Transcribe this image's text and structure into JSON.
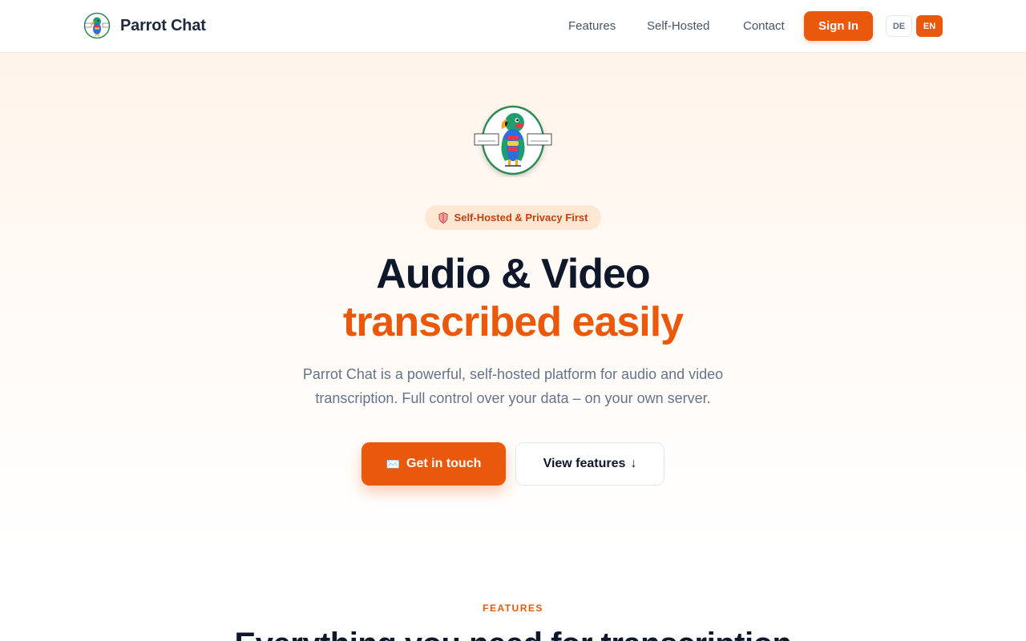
{
  "header": {
    "brand_name": "Parrot Chat",
    "nav": {
      "features": "Features",
      "self_hosted": "Self-Hosted",
      "contact": "Contact",
      "sign_in": "Sign In"
    },
    "languages": [
      {
        "code": "DE",
        "active": false
      },
      {
        "code": "EN",
        "active": true
      }
    ]
  },
  "hero": {
    "logo_icon": "parrot-logo",
    "badge": {
      "icon": "shield-icon",
      "label": "Self-Hosted & Privacy First"
    },
    "title_line_1": "Audio & Video",
    "title_line_2": "transcribed easily",
    "subtitle": "Parrot Chat is a powerful, self-hosted platform for audio and video transcription. Full control over your data – on your own server.",
    "cta_primary": {
      "icon": "envelope-icon",
      "label": "Get in touch"
    },
    "cta_secondary": {
      "label": "View features",
      "icon": "arrow-down-icon"
    }
  },
  "features": {
    "eyebrow": "FEATURES",
    "title": "Everything you need for transcription"
  },
  "colors": {
    "accent": "#ea580c",
    "heading": "#0f172a",
    "muted": "#64748b",
    "badge_bg": "#fde7d2"
  }
}
